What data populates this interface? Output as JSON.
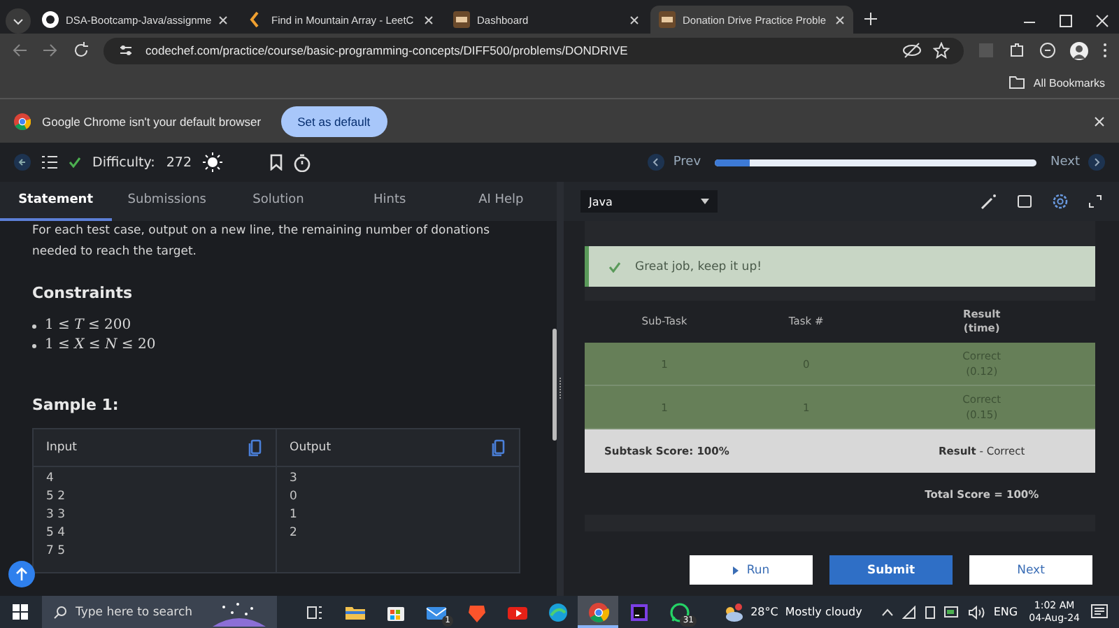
{
  "browser": {
    "tabs": [
      {
        "title": "DSA-Bootcamp-Java/assignme",
        "selected": false,
        "kind": "github"
      },
      {
        "title": "Find in Mountain Array - LeetC",
        "selected": false,
        "kind": "leetcode"
      },
      {
        "title": "Dashboard",
        "selected": false,
        "kind": "codechef"
      },
      {
        "title": "Donation Drive Practice Proble",
        "selected": true,
        "kind": "codechef"
      }
    ],
    "url": "codechef.com/practice/course/basic-programming-concepts/DIFF500/problems/DONDRIVE",
    "bookmarks": "All Bookmarks",
    "infobar": {
      "message": "Google Chrome isn't your default browser",
      "button": "Set as default"
    }
  },
  "header": {
    "difficulty_label": "Difficulty:",
    "difficulty": "272",
    "solved": true,
    "prev": "Prev",
    "next": "Next",
    "progress": {
      "level": 0.11
    }
  },
  "problem_tabs": [
    {
      "label": "Statement",
      "selected": true
    },
    {
      "label": "Submissions",
      "selected": false
    },
    {
      "label": "Solution",
      "selected": false
    },
    {
      "label": "Hints",
      "selected": false
    },
    {
      "label": "AI Help",
      "selected": false
    }
  ],
  "statement": {
    "paragraph": "For each test case, output on a new line, the remaining number of donations needed to reach the target.",
    "constraints_heading": "Constraints",
    "constraints": [
      "1 ≤ *T* ≤ 200",
      "1 ≤ *X* ≤ *N* ≤ 20"
    ],
    "sample_heading": "Sample 1:",
    "sample": {
      "input_label": "Input",
      "output_label": "Output",
      "input_lines": [
        "4",
        "5 2",
        "3 3",
        "5 4",
        "7 5"
      ],
      "output_lines": [
        "3",
        "0",
        "1",
        "2"
      ]
    }
  },
  "editor": {
    "language": "Java",
    "banner": "Great job, keep it up!",
    "results": {
      "columns": [
        "Sub-Task",
        "Task #",
        "Result\n(time)"
      ],
      "rows": [
        {
          "subtask": "1",
          "task": "0",
          "result": "Correct",
          "time": "(0.12)"
        },
        {
          "subtask": "1",
          "task": "1",
          "result": "Correct",
          "time": "(0.15)"
        }
      ],
      "subtask_score": "Subtask Score: 100%",
      "result_label": "Result",
      "result_separator": "-",
      "result_value": "Correct",
      "total_score": "Total Score = 100%"
    },
    "buttons": [
      {
        "label": "Run",
        "kind": "run"
      },
      {
        "label": "Submit",
        "kind": "submit"
      },
      {
        "label": "Next",
        "kind": "next"
      }
    ]
  },
  "taskbar": {
    "search_placeholder": "Type here to search",
    "apps": [
      {
        "kind": "taskview",
        "selected": false
      },
      {
        "kind": "folder",
        "selected": false
      },
      {
        "kind": "store",
        "selected": false
      },
      {
        "kind": "mail",
        "selected": false,
        "badge": "1"
      },
      {
        "kind": "brave",
        "selected": false
      },
      {
        "kind": "youtube",
        "selected": false
      },
      {
        "kind": "edge",
        "selected": false
      },
      {
        "kind": "chrome",
        "selected": true
      },
      {
        "kind": "ide",
        "selected": false
      },
      {
        "kind": "whatsapp",
        "selected": false,
        "badge": "31"
      }
    ],
    "temperature": "28°C",
    "weather": "Mostly cloudy",
    "language": "ENG",
    "time": "1:02 AM",
    "date": "04-Aug-24"
  }
}
